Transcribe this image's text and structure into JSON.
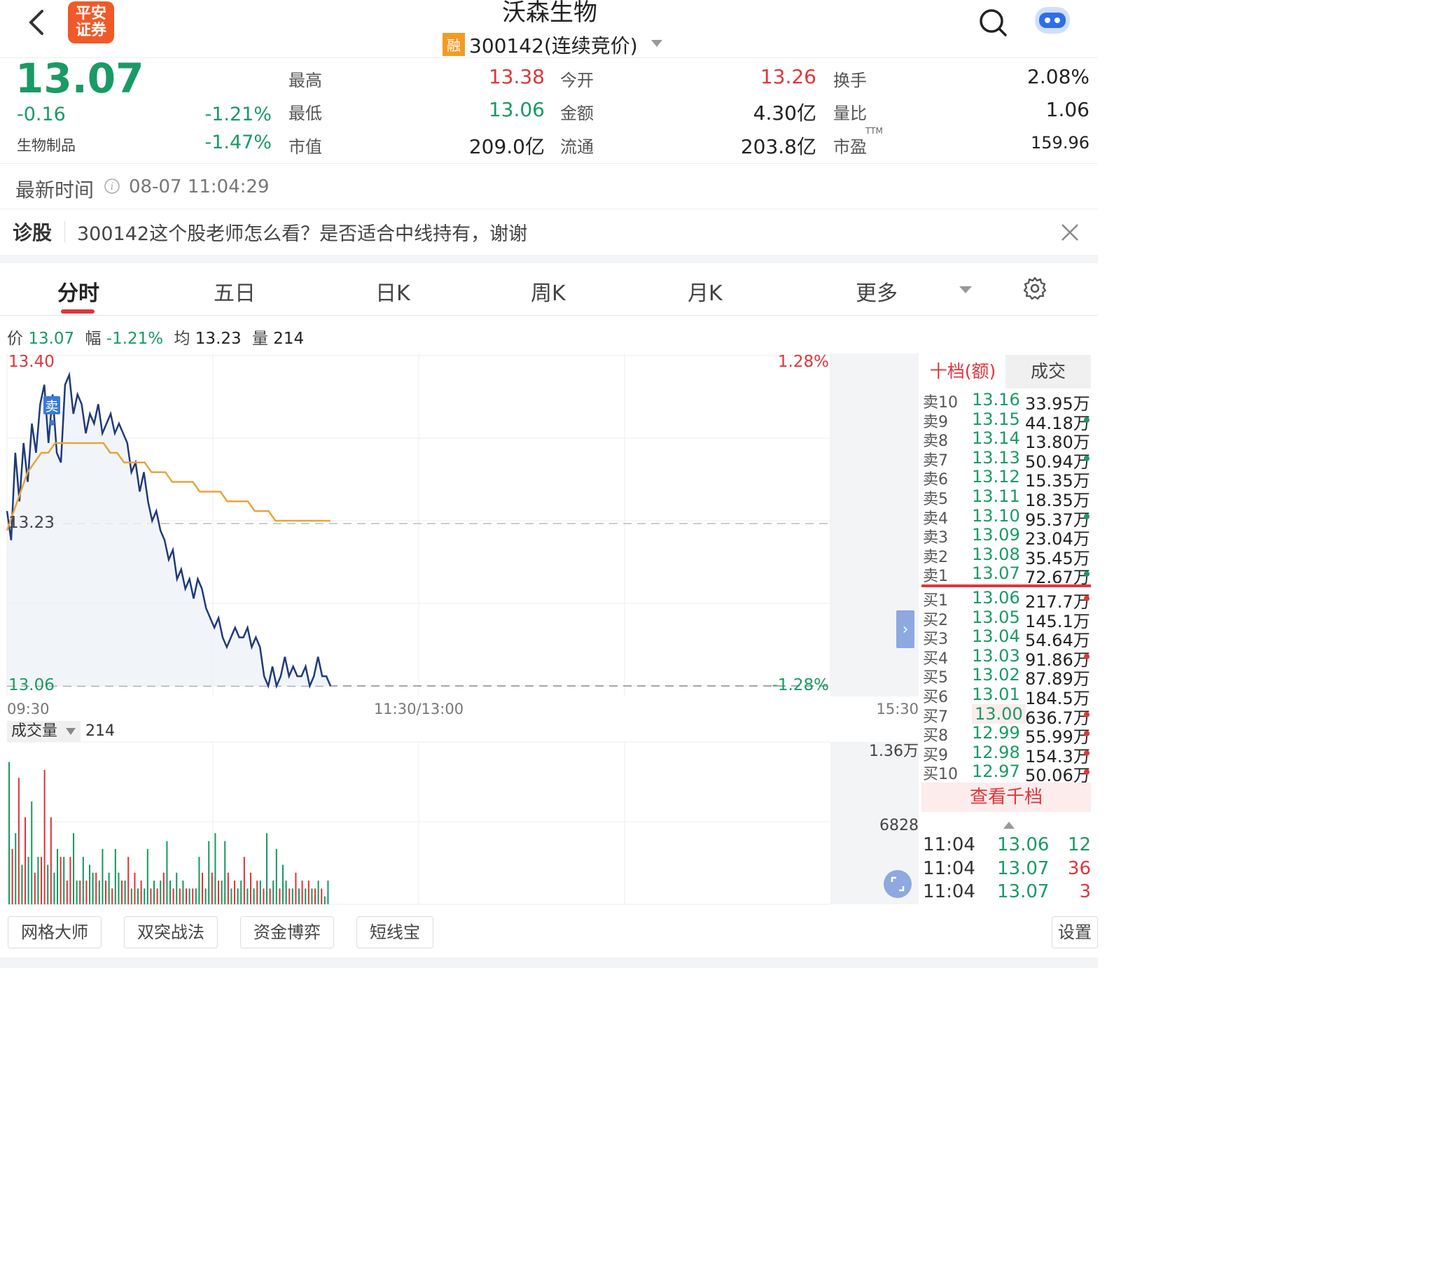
{
  "header": {
    "logo_line1": "平安",
    "logo_line2": "证券",
    "stock_name": "沃森生物",
    "rong_badge": "融",
    "code_status": "300142(连续竞价)"
  },
  "quote": {
    "price": "13.07",
    "change": "-0.16",
    "change_pct": "-1.21%",
    "sector": "生物制品",
    "sector_pct": "-1.47%",
    "high_label": "最高",
    "high": "13.38",
    "low_label": "最低",
    "low": "13.06",
    "mktcap_label": "市值",
    "mktcap": "209.0亿",
    "open_label": "今开",
    "open": "13.26",
    "amount_label": "金额",
    "amount": "4.30亿",
    "float_label": "流通",
    "float": "203.8亿",
    "turnover_label": "换手",
    "turnover": "2.08%",
    "volratio_label": "量比",
    "volratio": "1.06",
    "pe_label": "市盈",
    "pe_sup": "TTM",
    "pe": "159.96"
  },
  "latest": {
    "label": "最新时间",
    "time": "08-07 11:04:29"
  },
  "diagnose": {
    "label": "诊股",
    "question": "300142这个股老师怎么看？是否适合中线持有，谢谢"
  },
  "tabs": [
    "分时",
    "五日",
    "日K",
    "周K",
    "月K",
    "更多"
  ],
  "info_bar": {
    "price_label": "价",
    "price": "13.07",
    "amp_label": "幅",
    "amp": "-1.21%",
    "avg_label": "均",
    "avg": "13.23",
    "vol_label": "量",
    "vol": "214"
  },
  "chart_data": {
    "type": "line",
    "top_price": "13.40",
    "top_pct": "1.28%",
    "mid_price": "13.23",
    "bottom_price": "13.06",
    "bottom_pct": "-1.28%",
    "x_ticks": [
      "09:30",
      "11:30/13:00",
      "15:30"
    ],
    "sell_marker": "卖",
    "ylim": [
      13.06,
      13.4
    ],
    "series": [
      {
        "values": [
          13.24,
          13.21,
          13.3,
          13.25,
          13.31,
          13.27,
          13.33,
          13.3,
          13.35,
          13.37,
          13.31,
          13.36,
          13.3,
          13.29,
          13.37,
          13.38,
          13.34,
          13.36,
          13.35,
          13.32,
          13.34,
          13.33,
          13.35,
          13.32,
          13.33,
          13.34,
          13.32,
          13.33,
          13.32,
          13.31,
          13.28,
          13.29,
          13.26,
          13.28,
          13.25,
          13.23,
          13.24,
          13.22,
          13.21,
          13.19,
          13.2,
          13.17,
          13.18,
          13.16,
          13.17,
          13.15,
          13.17,
          13.16,
          13.14,
          13.13,
          13.12,
          13.13,
          13.11,
          13.1,
          13.11,
          13.12,
          13.11,
          13.11,
          13.12,
          13.1,
          13.11,
          13.1,
          13.07,
          13.06,
          13.08,
          13.06,
          13.07,
          13.09,
          13.07,
          13.08,
          13.07,
          13.07,
          13.08,
          13.06,
          13.07,
          13.09,
          13.07,
          13.07,
          13.06
        ]
      },
      {
        "values": [
          13.22,
          13.24,
          13.26,
          13.28,
          13.29,
          13.3,
          13.3,
          13.31,
          13.31,
          13.31,
          13.31,
          13.31,
          13.31,
          13.31,
          13.31,
          13.3,
          13.3,
          13.29,
          13.29,
          13.29,
          13.29,
          13.28,
          13.28,
          13.28,
          13.27,
          13.27,
          13.27,
          13.27,
          13.26,
          13.26,
          13.26,
          13.26,
          13.25,
          13.25,
          13.25,
          13.25,
          13.24,
          13.24,
          13.24,
          13.23,
          13.23,
          13.23,
          13.23,
          13.23,
          13.23,
          13.23,
          13.23,
          13.23
        ]
      }
    ]
  },
  "volume": {
    "label": "成交量",
    "value": "214",
    "scale_top": "1.36万",
    "scale_mid": "6828",
    "bars": [
      0.9,
      0.35,
      0.45,
      0.8,
      0.25,
      0.55,
      0.3,
      0.65,
      0.2,
      0.3,
      0.3,
      0.85,
      0.25,
      0.55,
      0.2,
      0.35,
      0.3,
      0.3,
      0.15,
      0.3,
      0.45,
      0.15,
      0.15,
      0.3,
      0.15,
      0.25,
      0.2,
      0.2,
      0.15,
      0.35,
      0.15,
      0.2,
      0.1,
      0.35,
      0.2,
      0.15,
      0.15,
      0.3,
      0.1,
      0.2,
      0.1,
      0.15,
      0.1,
      0.35,
      0.1,
      0.15,
      0.1,
      0.15,
      0.2,
      0.4,
      0.15,
      0.1,
      0.2,
      0.1,
      0.15,
      0.1,
      0.1,
      0.1,
      0.1,
      0.3,
      0.2,
      0.1,
      0.4,
      0.2,
      0.45,
      0.15,
      0.15,
      0.4,
      0.2,
      0.1,
      0.15,
      0.1,
      0.15,
      0.3,
      0.1,
      0.2,
      0.1,
      0.15,
      0.15,
      0.1,
      0.45,
      0.1,
      0.15,
      0.35,
      0.1,
      0.25,
      0.15,
      0.1,
      0.1,
      0.2,
      0.1,
      0.15,
      0.1,
      0.15,
      0.1,
      0.1,
      0.15,
      0.1,
      0.05,
      0.15
    ],
    "colors": [
      "g",
      "r",
      "g",
      "r",
      "g",
      "r",
      "g",
      "g",
      "r",
      "g",
      "r",
      "r",
      "g",
      "r",
      "g",
      "g",
      "r",
      "g",
      "r",
      "r",
      "g",
      "g",
      "r",
      "g",
      "r",
      "g",
      "g",
      "r",
      "g",
      "g",
      "r",
      "g",
      "r",
      "g",
      "g",
      "r",
      "g",
      "r",
      "g",
      "r",
      "g",
      "r",
      "g",
      "g",
      "r",
      "g",
      "r",
      "g",
      "r",
      "g",
      "g",
      "r",
      "g",
      "r",
      "g",
      "r",
      "g",
      "r",
      "g",
      "g",
      "r",
      "g",
      "g",
      "r",
      "g",
      "r",
      "g",
      "g",
      "r",
      "g",
      "r",
      "g",
      "g",
      "r",
      "g",
      "r",
      "g",
      "r",
      "g",
      "r",
      "g",
      "r",
      "g",
      "g",
      "r",
      "g",
      "g",
      "r",
      "g",
      "r",
      "g",
      "r",
      "g",
      "r",
      "g",
      "r",
      "g",
      "r",
      "g",
      "g"
    ]
  },
  "orderbook": {
    "tab_active": "十档(额)",
    "tab_inactive": "成交",
    "asks": [
      {
        "label": "卖10",
        "price": "13.16",
        "amount": "33.95万",
        "dot": ""
      },
      {
        "label": "卖9",
        "price": "13.15",
        "amount": "44.18万",
        "dot": "g"
      },
      {
        "label": "卖8",
        "price": "13.14",
        "amount": "13.80万",
        "dot": ""
      },
      {
        "label": "卖7",
        "price": "13.13",
        "amount": "50.94万",
        "dot": "g"
      },
      {
        "label": "卖6",
        "price": "13.12",
        "amount": "15.35万",
        "dot": ""
      },
      {
        "label": "卖5",
        "price": "13.11",
        "amount": "18.35万",
        "dot": ""
      },
      {
        "label": "卖4",
        "price": "13.10",
        "amount": "95.37万",
        "dot": "g"
      },
      {
        "label": "卖3",
        "price": "13.09",
        "amount": "23.04万",
        "dot": ""
      },
      {
        "label": "卖2",
        "price": "13.08",
        "amount": "35.45万",
        "dot": ""
      },
      {
        "label": "卖1",
        "price": "13.07",
        "amount": "72.67万",
        "dot": "g"
      }
    ],
    "bids": [
      {
        "label": "买1",
        "price": "13.06",
        "amount": "217.7万",
        "dot": "r"
      },
      {
        "label": "买2",
        "price": "13.05",
        "amount": "145.1万",
        "dot": ""
      },
      {
        "label": "买3",
        "price": "13.04",
        "amount": "54.64万",
        "dot": ""
      },
      {
        "label": "买4",
        "price": "13.03",
        "amount": "91.86万",
        "dot": "r"
      },
      {
        "label": "买5",
        "price": "13.02",
        "amount": "87.89万",
        "dot": ""
      },
      {
        "label": "买6",
        "price": "13.01",
        "amount": "184.5万",
        "dot": ""
      },
      {
        "label": "买7",
        "price": "13.00",
        "amount": "636.7万",
        "dot": "r"
      },
      {
        "label": "买8",
        "price": "12.99",
        "amount": "55.99万",
        "dot": "r"
      },
      {
        "label": "买9",
        "price": "12.98",
        "amount": "154.3万",
        "dot": "r"
      },
      {
        "label": "买10",
        "price": "12.97",
        "amount": "50.06万",
        "dot": "r"
      }
    ],
    "view_more": "查看千档",
    "trades": [
      {
        "time": "11:04",
        "price": "13.06",
        "vol": "12"
      },
      {
        "time": "11:04",
        "price": "13.07",
        "vol": "36"
      },
      {
        "time": "11:04",
        "price": "13.07",
        "vol": "3"
      }
    ]
  },
  "toolbar": {
    "buttons": [
      "网格大师",
      "双突战法",
      "资金博弈",
      "短线宝"
    ],
    "settings": "设置"
  },
  "colors": {
    "up": "#e0353a",
    "down": "#1a9a64",
    "price_line": "#1f3a7a",
    "avg_line": "#e8a33a"
  }
}
